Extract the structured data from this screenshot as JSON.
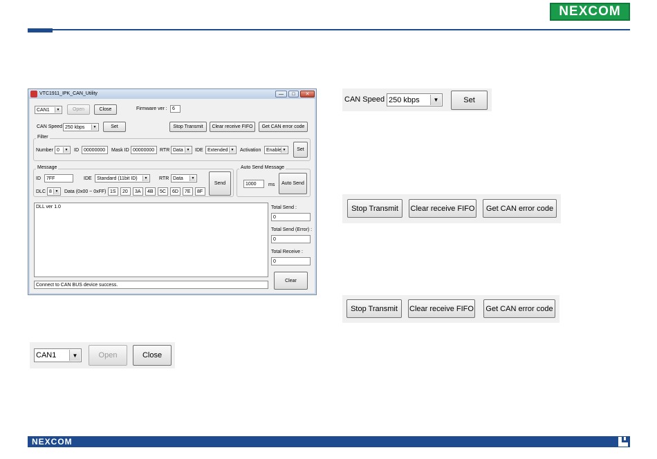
{
  "branding": {
    "logo": "NEXCOM"
  },
  "window": {
    "title": "VTC1911_IPK_CAN_Utility",
    "minimize": "—",
    "maximize": "□",
    "close": "✕",
    "port": {
      "value": "CAN1",
      "open": "Open",
      "close": "Close"
    },
    "firmware": {
      "label": "Firmware ver :",
      "value": "6"
    },
    "speed": {
      "label": "CAN Speed",
      "value": "250  kbps",
      "set": "Set"
    },
    "actions": {
      "stop": "Stop Transmit",
      "clear_fifo": "Clear receive FIFO",
      "get_error": "Get CAN error code"
    },
    "filter": {
      "title": "Filter",
      "number_label": "Number",
      "number": "0",
      "id_label": "ID",
      "id": "00000000",
      "mask_label": "Mask ID",
      "mask": "00000000",
      "rtr_label": "RTR",
      "rtr": "Data",
      "ide_label": "IDE",
      "ide": "Extended",
      "activation_label": "Activation",
      "activation": "Enable",
      "set": "Set"
    },
    "message": {
      "title": "Message",
      "id_label": "ID",
      "id": "7FF",
      "ide_label": "IDE",
      "ide": "Standard (11bit ID)",
      "rtr_label": "RTR",
      "rtr": "Data",
      "dlc_label": "DLC",
      "dlc": "8",
      "data_label": "Data (0x00 ~ 0xFF)",
      "data": [
        "1S",
        "20",
        "3A",
        "4B",
        "5C",
        "6D",
        "7E",
        "8F"
      ],
      "send": "Send"
    },
    "auto_send": {
      "title": "Auto Send Message",
      "interval": "1000",
      "unit": "ms",
      "button": "Auto Send"
    },
    "log": {
      "text": "DLL ver 1.0"
    },
    "totals": {
      "send_label": "Total Send :",
      "send": "0",
      "error_label": "Total Send (Error) :",
      "error": "0",
      "receive_label": "Total Receive :",
      "receive": "0",
      "clear": "Clear"
    },
    "status": "Connect to CAN BUS device success."
  },
  "zoom_speed": {
    "label": "CAN Speed",
    "value": "250  kbps",
    "set": "Set"
  },
  "zoom_actions_1": {
    "stop": "Stop Transmit",
    "clear_fifo": "Clear receive FIFO",
    "get_error": "Get CAN error code"
  },
  "zoom_actions_2": {
    "stop": "Stop Transmit",
    "clear_fifo": "Clear receive FIFO",
    "get_error": "Get CAN error code"
  },
  "zoom_port": {
    "value": "CAN1",
    "open": "Open",
    "close": "Close"
  },
  "footer": {
    "logo": "NEXCOM"
  }
}
